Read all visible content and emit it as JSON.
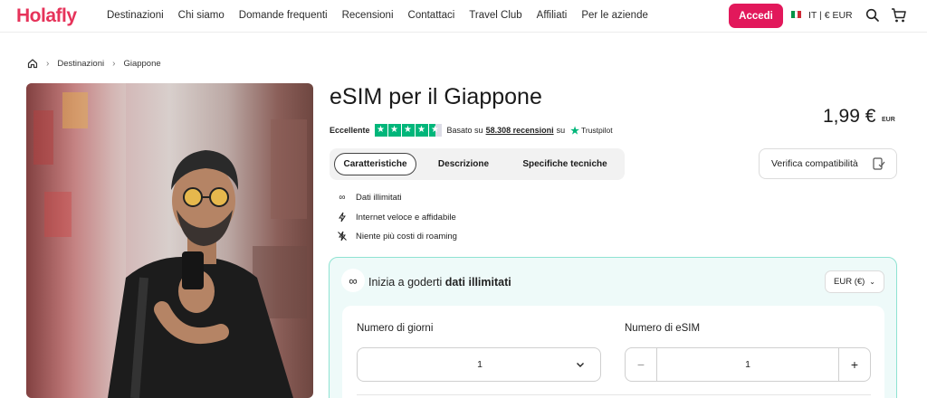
{
  "header": {
    "logo": "Holafly",
    "nav": [
      "Destinazioni",
      "Chi siamo",
      "Domande frequenti",
      "Recensioni",
      "Contattaci",
      "Travel Club",
      "Affiliati",
      "Per le aziende"
    ],
    "login_label": "Accedi",
    "locale_label": "IT | € EUR",
    "flag_colors": [
      "#009246",
      "#ffffff",
      "#ce2b37"
    ],
    "accent": "#e2185b"
  },
  "breadcrumb": {
    "home_icon": "home-icon",
    "items": [
      "Destinazioni",
      "Giappone"
    ]
  },
  "product": {
    "title": "eSIM per il Giappone",
    "price": "1,99 €",
    "price_currency": "EUR",
    "rating": {
      "label": "Eccellente",
      "stars": 4.5,
      "based_on": "Basato su",
      "reviews": "58.308 recensioni",
      "on": "su",
      "provider": "Trustpilot"
    },
    "tabs": [
      "Caratteristiche",
      "Descrizione",
      "Specifiche tecniche"
    ],
    "verify_label": "Verifica compatibilità",
    "features": [
      {
        "icon": "infinity-icon",
        "text": "Dati illimitati"
      },
      {
        "icon": "lightning-icon",
        "text": "Internet veloce e affidabile"
      },
      {
        "icon": "no-roaming-icon",
        "text": "Niente più costi di roaming"
      }
    ]
  },
  "plan": {
    "heading_prefix": "Inizia a goderti",
    "heading_bold": "dati illimitati",
    "currency": "EUR (€)",
    "days_label": "Numero di giorni",
    "days_value": "1",
    "sims_label": "Numero di eSIM",
    "sims_value": "1",
    "minus": "−",
    "plus": "+"
  }
}
